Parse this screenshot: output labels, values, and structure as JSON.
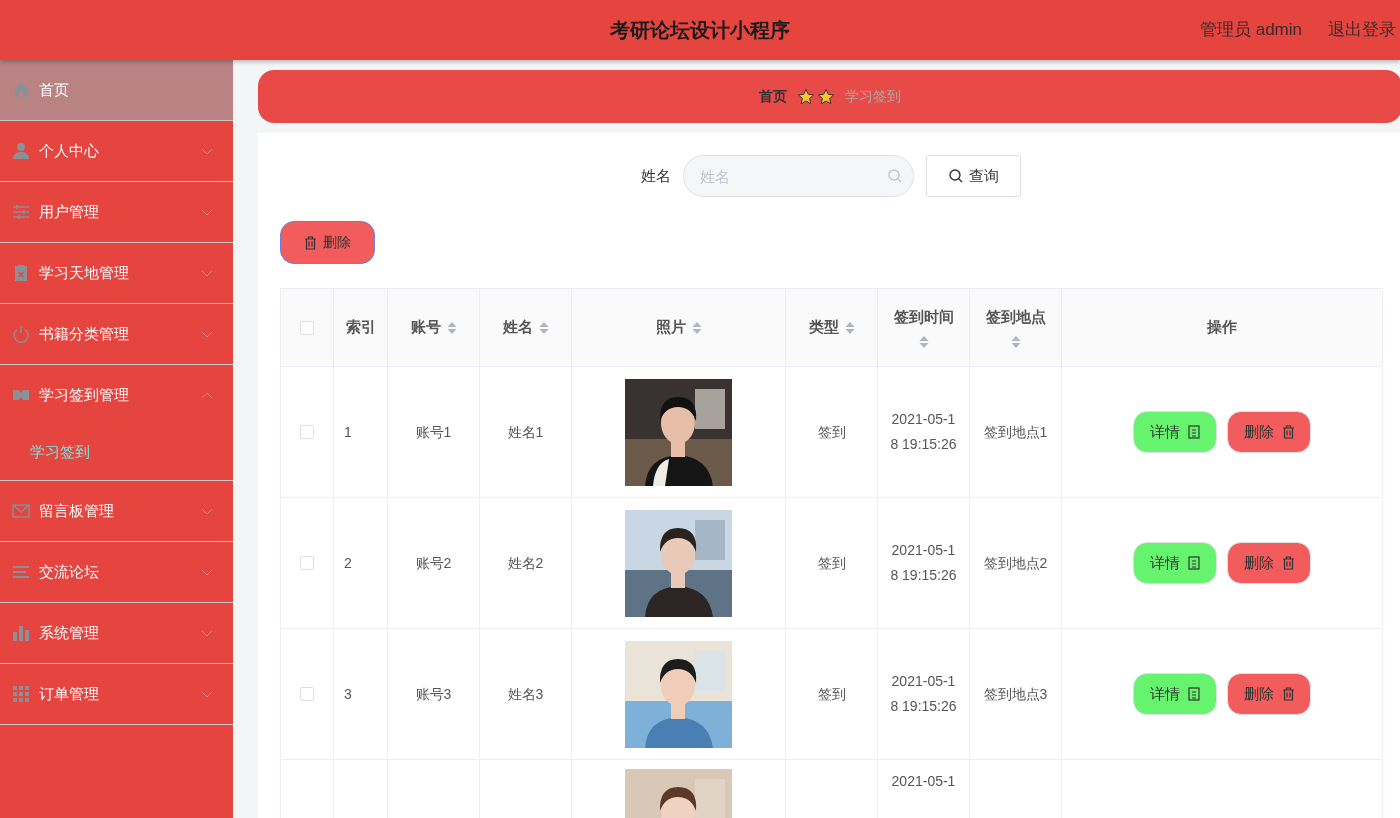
{
  "header": {
    "title": "考研论坛设计小程序",
    "user": "管理员 admin",
    "logout": "退出登录"
  },
  "sidebar": {
    "items": [
      {
        "label": "首页",
        "kind": "link",
        "selected": true
      },
      {
        "label": "个人中心",
        "kind": "menu",
        "expanded": false,
        "selected": false
      },
      {
        "label": "用户管理",
        "kind": "menu",
        "expanded": false,
        "selected": false
      },
      {
        "label": "学习天地管理",
        "kind": "menu",
        "expanded": false,
        "selected": false
      },
      {
        "label": "书籍分类管理",
        "kind": "menu",
        "expanded": false,
        "selected": false
      },
      {
        "label": "学习签到管理",
        "kind": "menu",
        "expanded": true,
        "selected": false,
        "children": [
          {
            "label": "学习签到",
            "selected": true
          }
        ]
      },
      {
        "label": "留言板管理",
        "kind": "menu",
        "expanded": false,
        "selected": false
      },
      {
        "label": "交流论坛",
        "kind": "menu",
        "expanded": false,
        "selected": false
      },
      {
        "label": "系统管理",
        "kind": "menu",
        "expanded": false,
        "selected": false
      },
      {
        "label": "订单管理",
        "kind": "menu",
        "expanded": false,
        "selected": false
      }
    ]
  },
  "breadcrumb": [
    "首页",
    "学习签到"
  ],
  "search": {
    "label": "姓名",
    "placeholder": "姓名",
    "button": "查询"
  },
  "bulk_delete": "删除",
  "table": {
    "select_all": {
      "checked": false
    },
    "columns": [
      {
        "label": "索引",
        "sortable": false
      },
      {
        "label": "账号",
        "sortable": true
      },
      {
        "label": "姓名",
        "sortable": true
      },
      {
        "label": "照片",
        "sortable": true
      },
      {
        "label": "类型",
        "sortable": true
      },
      {
        "label": "签到时间",
        "sortable": true
      },
      {
        "label": "签到地点",
        "sortable": true
      },
      {
        "label": "操作",
        "sortable": false
      }
    ],
    "rows": [
      {
        "checked": false,
        "index": "1",
        "account": "账号1",
        "name": "姓名1",
        "type": "签到",
        "time": "2021-05-18 19:15:26",
        "place": "签到地点1",
        "actions": [
          "详情",
          "删除"
        ]
      },
      {
        "checked": false,
        "index": "2",
        "account": "账号2",
        "name": "姓名2",
        "type": "签到",
        "time": "2021-05-18 19:15:26",
        "place": "签到地点2",
        "actions": [
          "详情",
          "删除"
        ]
      },
      {
        "checked": false,
        "index": "3",
        "account": "账号3",
        "name": "姓名3",
        "type": "签到",
        "time": "2021-05-18 19:15:26",
        "place": "签到地点3",
        "actions": [
          "详情",
          "删除"
        ]
      },
      {
        "time": "2021-05-1"
      }
    ]
  }
}
